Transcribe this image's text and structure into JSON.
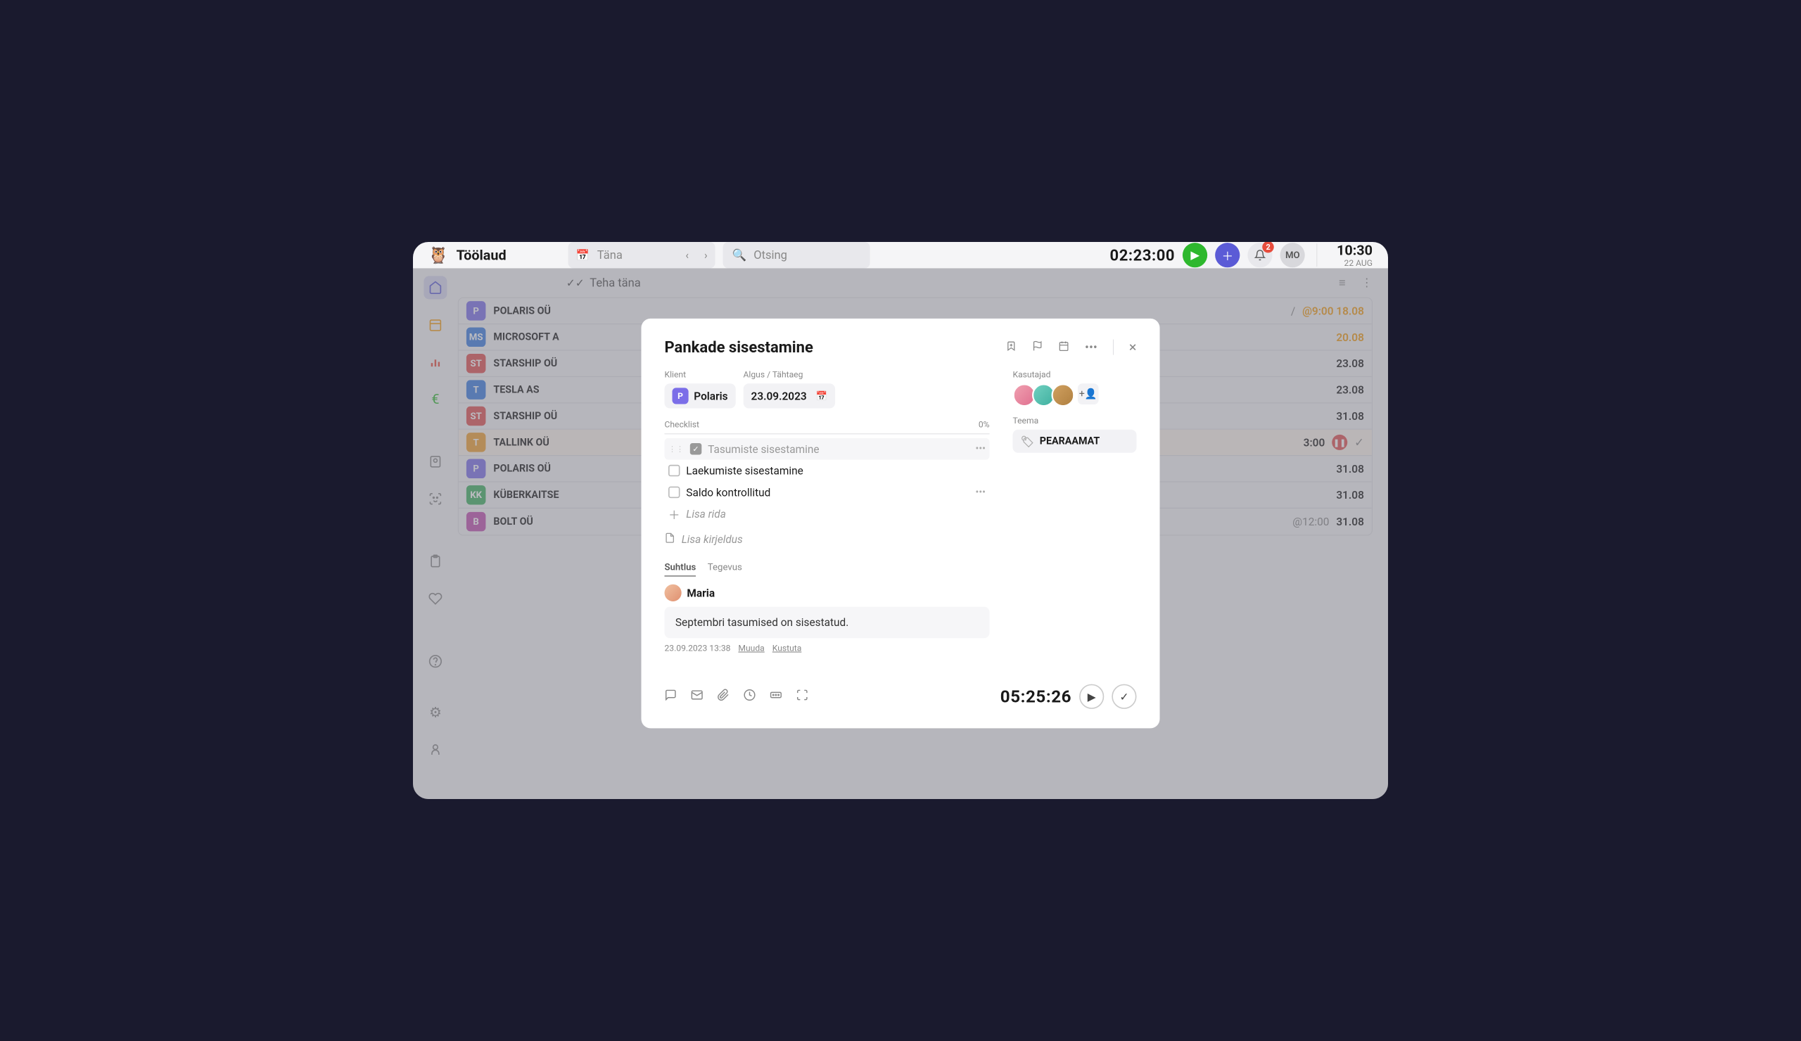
{
  "header": {
    "title": "Töölaud",
    "today_label": "Täna",
    "search_placeholder": "Otsing",
    "timer": "02:23:00",
    "notification_count": "2",
    "user_initials": "MO",
    "clock_time": "10:30",
    "clock_date": "22 AUG"
  },
  "tabs": {
    "todo_today": "Teha täna"
  },
  "clients": [
    {
      "badge": "P",
      "color": "cb-purple",
      "name": "POLARIS OÜ",
      "right_time": "@9:00",
      "right_date": "18.08",
      "orange": true
    },
    {
      "badge": "MS",
      "color": "cb-blue",
      "name": "MICROSOFT A",
      "right_date": "20.08",
      "orange": true
    },
    {
      "badge": "ST",
      "color": "cb-red",
      "name": "STARSHIP OÜ",
      "right_date": "23.08"
    },
    {
      "badge": "T",
      "color": "cb-blue",
      "name": "TESLA AS",
      "right_date": "23.08"
    },
    {
      "badge": "ST",
      "color": "cb-red",
      "name": "STARSHIP OÜ",
      "right_date": "31.08"
    },
    {
      "badge": "T",
      "color": "cb-orange",
      "name": "TALLINK OÜ",
      "right_time": "3:00",
      "highlighted": true,
      "pause": true,
      "check": true
    },
    {
      "badge": "P",
      "color": "cb-purple",
      "name": "POLARIS OÜ",
      "right_date": "31.08"
    },
    {
      "badge": "KK",
      "color": "cb-green",
      "name": "KÜBERKAITSE",
      "right_date": "31.08"
    },
    {
      "badge": "B",
      "color": "cb-magenta",
      "name": "BOLT OÜ",
      "right_time": "@12:00",
      "right_date": "31.08"
    }
  ],
  "modal": {
    "title": "Pankade sisestamine",
    "client_label": "Klient",
    "client_name": "Polaris",
    "client_badge": "P",
    "date_label": "Algus / Tähtaeg",
    "date_value": "23.09.2023",
    "users_label": "Kasutajad",
    "tag_label": "Teema",
    "tag_value": "PEARAAMAT",
    "checklist_label": "Checklist",
    "checklist_progress": "0%",
    "items": [
      {
        "text": "Tasumiste sisestamine",
        "done": true
      },
      {
        "text": "Laekumiste sisestamine",
        "done": false
      },
      {
        "text": "Saldo kontrollitud",
        "done": false,
        "dots": true
      }
    ],
    "add_row": "Lisa rida",
    "add_desc": "Lisa kirjeldus",
    "tab_chat": "Suhtlus",
    "tab_activity": "Tegevus",
    "comment_author": "Maria",
    "comment_body": "Septembri tasumised on sisestatud.",
    "comment_time": "23.09.2023 13:38",
    "comment_edit": "Muuda",
    "comment_delete": "Kustuta",
    "footer_timer": "05:25:26"
  }
}
